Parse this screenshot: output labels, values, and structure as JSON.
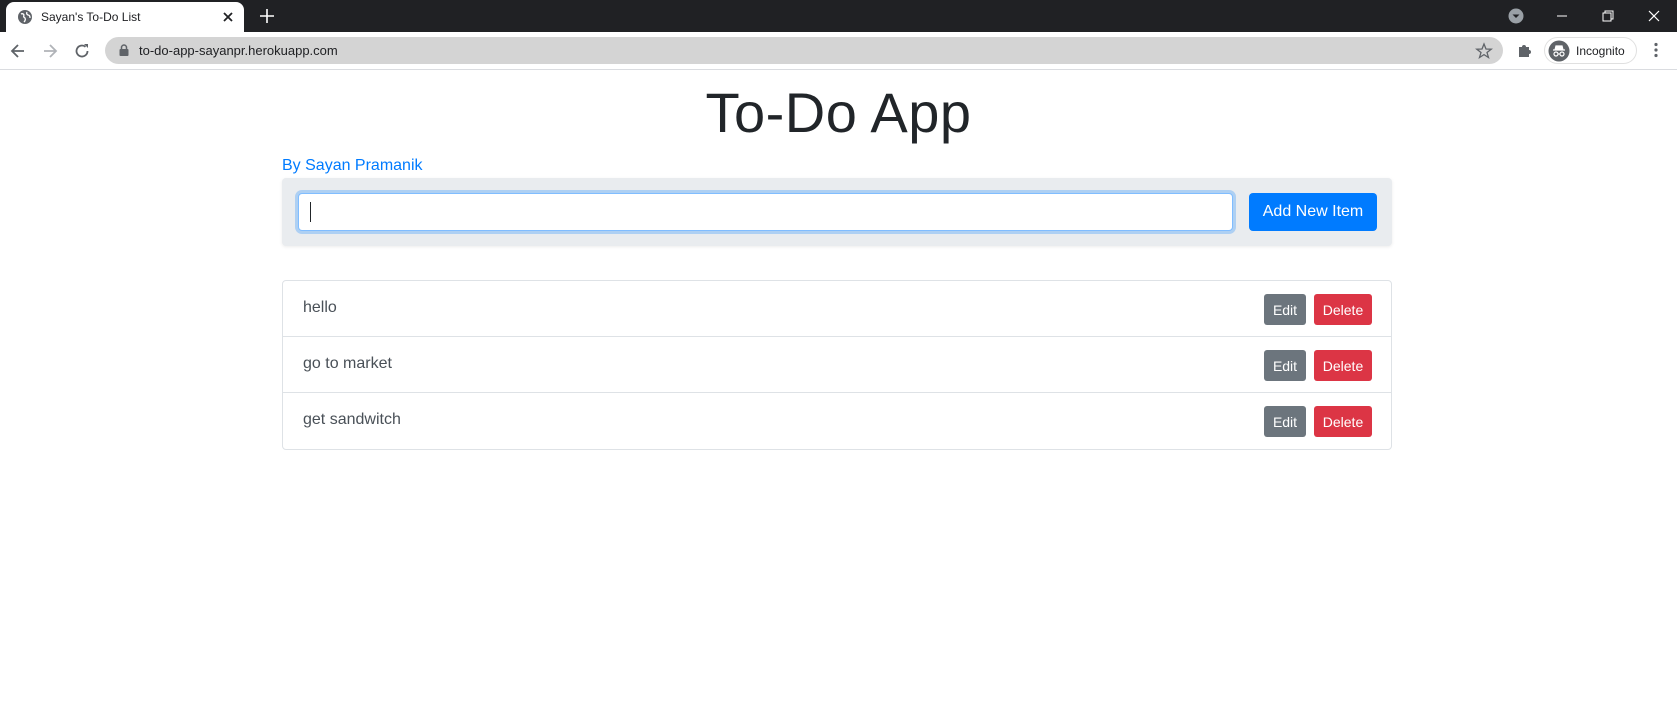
{
  "browser": {
    "tab_title": "Sayan's To-Do List",
    "url": "to-do-app-sayanpr.herokuapp.com",
    "profile_label": "Incognito",
    "icons": {
      "favicon": "globe-icon",
      "tab_close": "close-icon",
      "new_tab": "plus-icon",
      "back": "arrow-left-icon",
      "forward": "arrow-right-icon",
      "reload": "reload-icon",
      "lock": "lock-icon",
      "bookmark": "star-icon",
      "extensions": "puzzle-icon",
      "incognito": "incognito-icon",
      "menu": "kebab-menu-icon"
    }
  },
  "app": {
    "title": "To-Do App",
    "author": "By Sayan Pramanik",
    "input_value": "",
    "add_button_label": "Add New Item",
    "items": [
      {
        "text": "hello",
        "edit_label": "Edit",
        "delete_label": "Delete"
      },
      {
        "text": "go to market",
        "edit_label": "Edit",
        "delete_label": "Delete"
      },
      {
        "text": "get sandwitch",
        "edit_label": "Edit",
        "delete_label": "Delete"
      }
    ]
  },
  "colors": {
    "primary": "#007bff",
    "secondary": "#6c757d",
    "danger": "#dc3545",
    "form_bg": "#e9ecef"
  }
}
